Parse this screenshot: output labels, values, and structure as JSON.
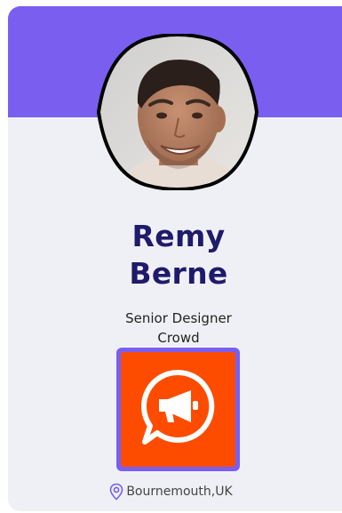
{
  "profile": {
    "first_name": "Remy",
    "last_name": "Berne",
    "role": "Senior Designer",
    "company": "Crowd",
    "location": "Bournemouth,UK"
  },
  "icons": {
    "logo": "megaphone-chat-icon",
    "location": "map-pin-icon"
  },
  "colors": {
    "accent": "#7a5ef0",
    "card_bg": "#eff0f5",
    "name_text": "#201a6b",
    "logo_bg": "#fd4c00"
  }
}
